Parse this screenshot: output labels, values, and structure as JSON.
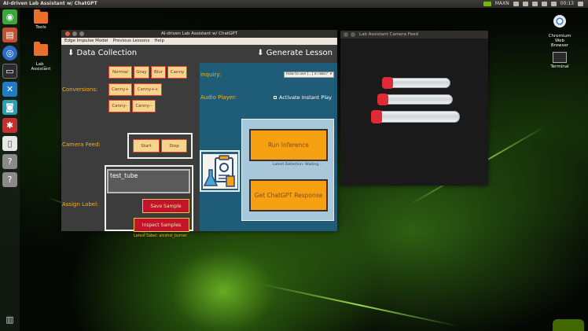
{
  "top_panel": {
    "title": "AI-driven Lab Assistant w/ ChatGPT",
    "maxn": "MAXN",
    "time": "00:13"
  },
  "desktop": {
    "icons": [
      {
        "label": "Tools"
      },
      {
        "label": "Lab_\nAssistant"
      },
      {
        "label": "Chromium\nWeb\nBrowser"
      },
      {
        "label": "Terminal"
      }
    ]
  },
  "app": {
    "title": "AI-driven Lab Assistant w/ ChatGPT",
    "menu": [
      "Edge Impulse Model",
      "Previous Lessons",
      "Help"
    ],
    "left": {
      "heading": "⬇ Data Collection",
      "conversions_label": "Conversions:",
      "conversions": [
        "Normal",
        "Gray",
        "Blur",
        "Canny",
        "Canny+",
        "Canny++",
        "Canny-",
        "Canny--"
      ],
      "camera_label": "Camera Feed:",
      "start": "Start",
      "stop": "Stop",
      "assign_label": "Assign Label:",
      "label_value": "test_tube",
      "save": "Save Sample",
      "inspect": "Inspect Samples",
      "latest_label": "Latest Label: alcohol_burner"
    },
    "right": {
      "heading": "⬇ Generate Lesson",
      "inquiry_label": "Inquiry:",
      "inquiry_value": "How to use [...] in labs?",
      "audio_label": "Audio Player:",
      "instant_play": "Activate Instant Play",
      "run_inference": "Run Inference",
      "latest_detection": "Latest Detection: Waiting...",
      "chatgpt": "Get ChatGPT Response"
    }
  },
  "camera_window": {
    "title": "Lab Assistant Camera Feed"
  },
  "colors": {
    "accent": "#f2b21e",
    "tile_bg": "#f6d48e",
    "red_button": "#c2152a",
    "orange_button": "#f5a111",
    "right_pane": "#1f5c78"
  }
}
